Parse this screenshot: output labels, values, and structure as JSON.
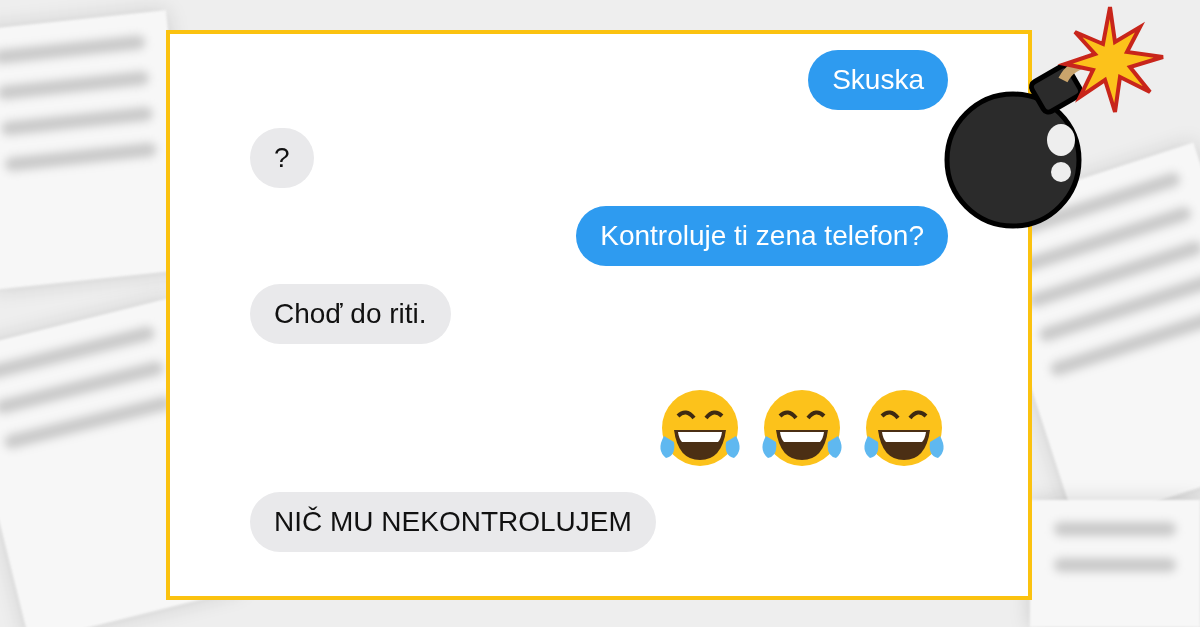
{
  "messages": [
    {
      "kind": "sent",
      "text": "Skuska"
    },
    {
      "kind": "received",
      "text": "?"
    },
    {
      "kind": "sent",
      "text": "Kontroluje ti zena telefon?"
    },
    {
      "kind": "received",
      "text": "Choď do riti."
    },
    {
      "kind": "sent-emoji"
    },
    {
      "kind": "received",
      "text": "NIČ MU NEKONTROLUJEM"
    }
  ]
}
